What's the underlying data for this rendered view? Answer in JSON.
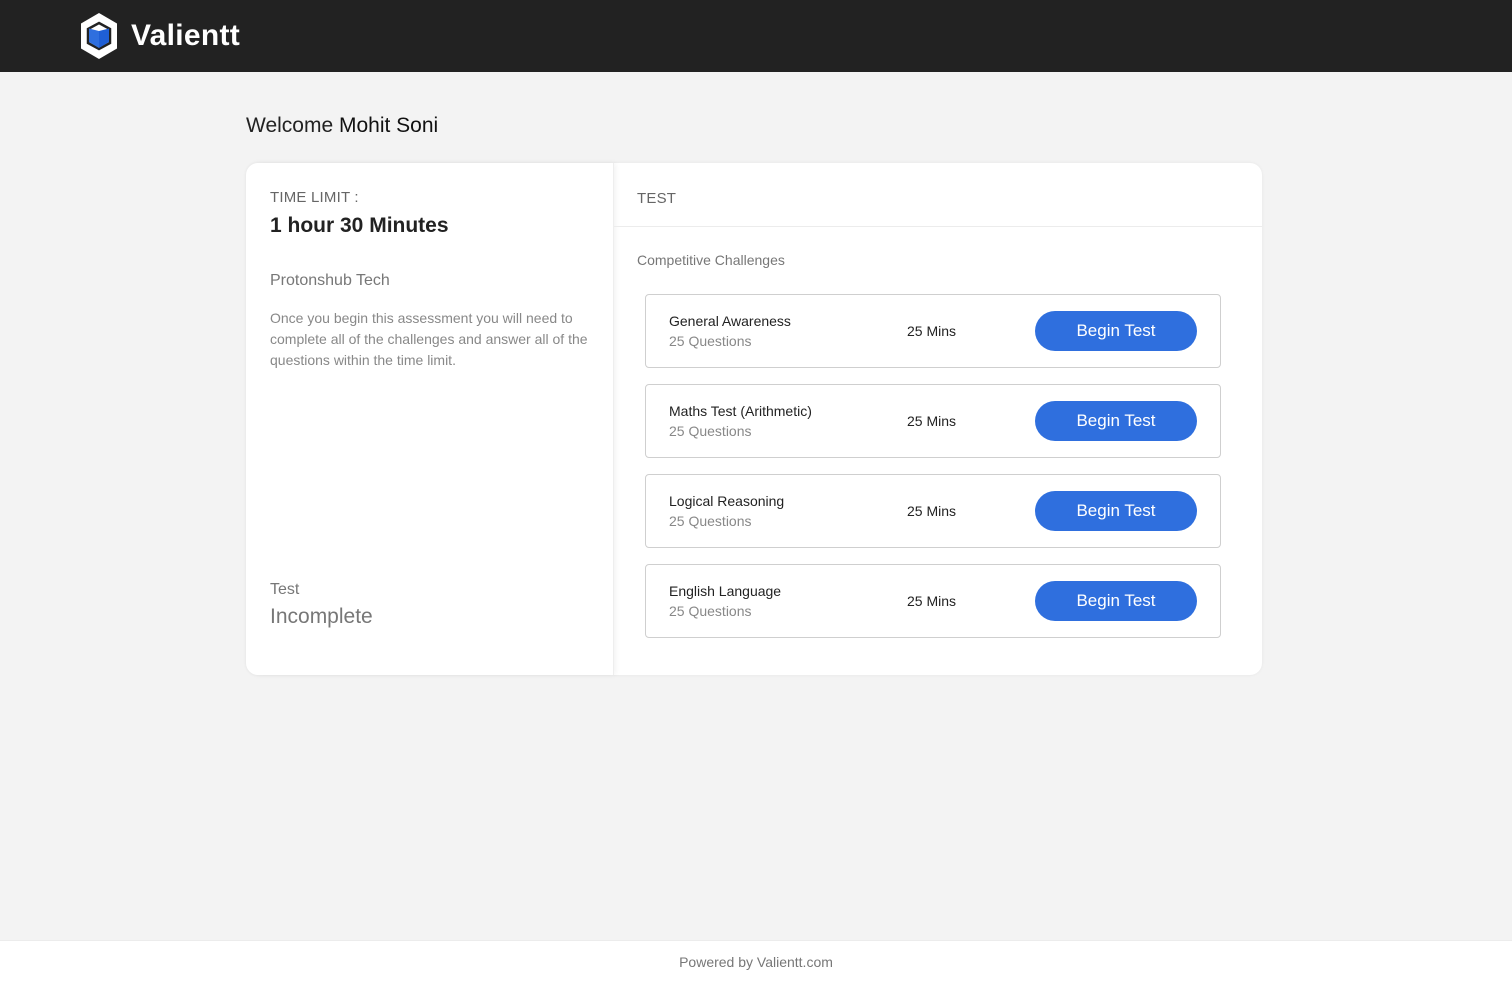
{
  "brand": {
    "name": "Valientt",
    "colors": {
      "header_bg": "#222222",
      "accent": "#2f6fde",
      "logo_blue": "#1f5fd6"
    }
  },
  "welcome": {
    "prefix": "Welcome",
    "name": "Mohit Soni"
  },
  "summary": {
    "time_limit_label": "TIME LIMIT :",
    "time_limit_value": "1 hour 30 Minutes",
    "company": "Protonshub Tech",
    "description": "Once you begin this assessment you will need to complete all of the challenges and answer all of the questions within the time limit.",
    "status_label": "Test",
    "status_value": "Incomplete"
  },
  "tests_panel": {
    "header": "TEST",
    "section_title": "Competitive Challenges",
    "items": [
      {
        "name": "General Awareness",
        "questions": "25 Questions",
        "duration": "25 Mins",
        "button_label": "Begin Test"
      },
      {
        "name": "Maths Test (Arithmetic)",
        "questions": "25 Questions",
        "duration": "25 Mins",
        "button_label": "Begin Test"
      },
      {
        "name": "Logical Reasoning",
        "questions": "25 Questions",
        "duration": "25 Mins",
        "button_label": "Begin Test"
      },
      {
        "name": "English Language",
        "questions": "25 Questions",
        "duration": "25 Mins",
        "button_label": "Begin Test"
      }
    ]
  },
  "footer": {
    "text": "Powered by Valientt.com"
  }
}
